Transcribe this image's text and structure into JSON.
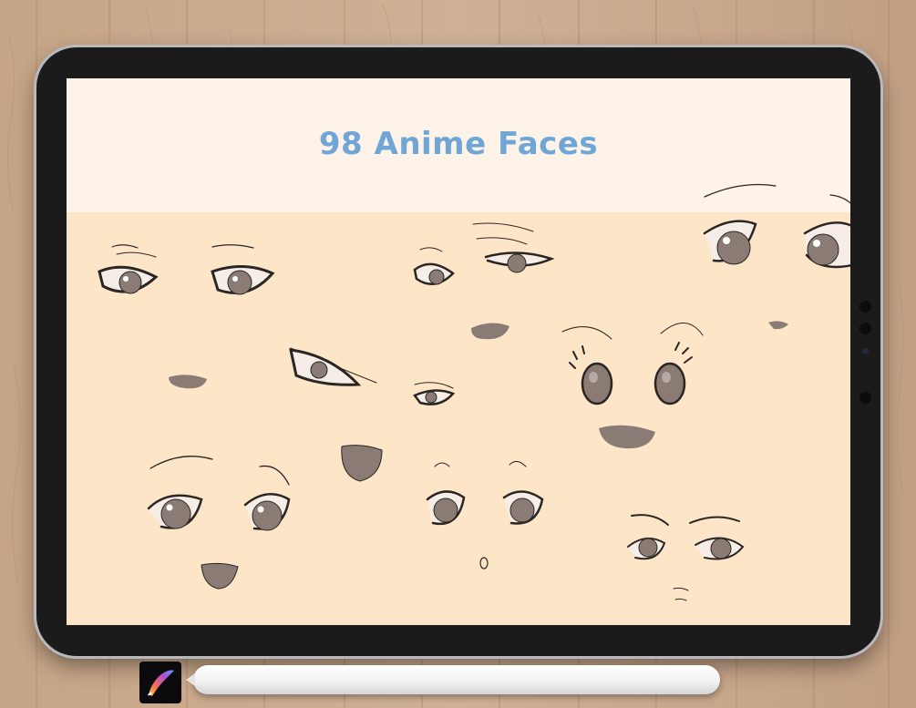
{
  "screen": {
    "title": "98 Anime Faces"
  },
  "icons": {
    "app": "procreate-app-icon",
    "stylus": "apple-pencil"
  },
  "colors": {
    "title": "#6fa6d6",
    "header_bg": "#fdf3e9",
    "canvas_bg": "#fde6c8",
    "ink": "#2a2624",
    "iris": "#8a7b74"
  }
}
